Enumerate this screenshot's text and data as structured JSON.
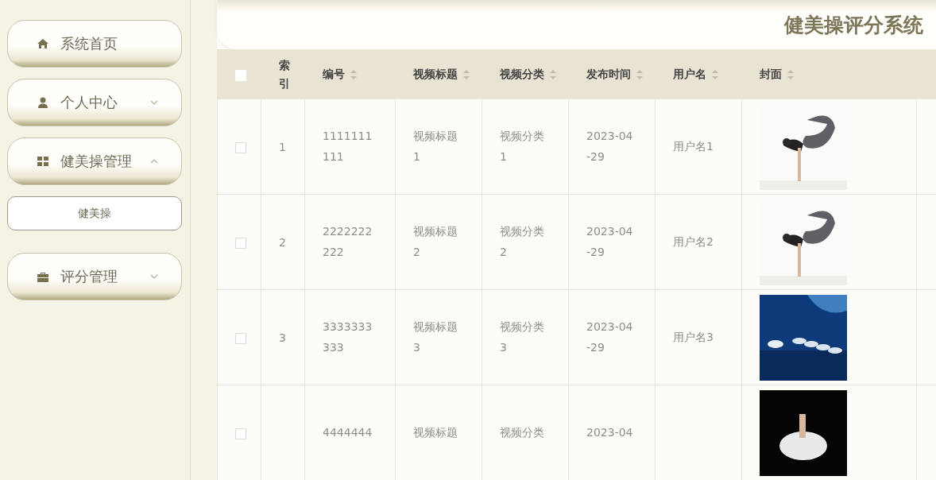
{
  "title": "健美操评分系统",
  "sidebar": {
    "items": [
      {
        "label": "系统首页",
        "kind": "home"
      },
      {
        "label": "个人中心",
        "kind": "user",
        "expanded": false
      },
      {
        "label": "健美操管理",
        "kind": "grid",
        "expanded": true,
        "children": [
          {
            "label": "健美操"
          }
        ]
      },
      {
        "label": "评分管理",
        "kind": "case",
        "expanded": false
      }
    ]
  },
  "table": {
    "header_checked": false,
    "columns": [
      {
        "label": "索引",
        "sortable": false
      },
      {
        "label": "编号",
        "sortable": true
      },
      {
        "label": "视频标题",
        "sortable": true
      },
      {
        "label": "视频分类",
        "sortable": true
      },
      {
        "label": "发布时间",
        "sortable": true
      },
      {
        "label": "用户名",
        "sortable": true
      },
      {
        "label": "封面",
        "sortable": true
      }
    ],
    "rows": [
      {
        "checked": false,
        "index": "1",
        "number": "1111111111",
        "title": "视频标题1",
        "category": "视频分类1",
        "time": "2023-04-29",
        "user": "用户名1"
      },
      {
        "checked": false,
        "index": "2",
        "number": "2222222222",
        "title": "视频标题2",
        "category": "视频分类2",
        "time": "2023-04-29",
        "user": "用户名2"
      },
      {
        "checked": false,
        "index": "3",
        "number": "3333333333",
        "title": "视频标题3",
        "category": "视频分类3",
        "time": "2023-04-29",
        "user": "用户名3"
      },
      {
        "checked": false,
        "number": "4444444",
        "title": "视频标题",
        "category": "视频分类",
        "time": "2023-04"
      }
    ]
  }
}
